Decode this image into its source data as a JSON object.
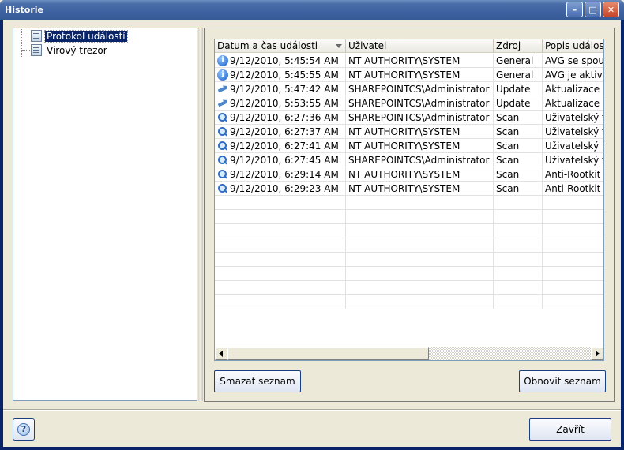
{
  "window": {
    "title": "Historie"
  },
  "tree": {
    "items": [
      {
        "label": "Protokol událostí",
        "selected": true
      },
      {
        "label": "Virový trezor",
        "selected": false
      }
    ]
  },
  "table": {
    "columns": [
      "Datum a čas události",
      "Uživatel",
      "Zdroj",
      "Popis události"
    ],
    "sorted_column": "Datum a čas události",
    "rows": [
      {
        "icon": "info-icon",
        "datetime": "9/12/2010, 5:45:54 AM",
        "user": "NT AUTHORITY\\SYSTEM",
        "source": "General",
        "desc": "AVG se spouš"
      },
      {
        "icon": "info-icon",
        "datetime": "9/12/2010, 5:45:55 AM",
        "user": "NT AUTHORITY\\SYSTEM",
        "source": "General",
        "desc": "AVG je aktivn"
      },
      {
        "icon": "update-icon",
        "datetime": "9/12/2010, 5:47:42 AM",
        "user": "SHAREPOINTCS\\Administrator",
        "source": "Update",
        "desc": "Aktualizace b"
      },
      {
        "icon": "update-icon",
        "datetime": "9/12/2010, 5:53:55 AM",
        "user": "SHAREPOINTCS\\Administrator",
        "source": "Update",
        "desc": "Aktualizace b"
      },
      {
        "icon": "scan-icon",
        "datetime": "9/12/2010, 6:27:36 AM",
        "user": "SHAREPOINTCS\\Administrator",
        "source": "Scan",
        "desc": "Uživatelský te"
      },
      {
        "icon": "scan-icon",
        "datetime": "9/12/2010, 6:27:37 AM",
        "user": "NT AUTHORITY\\SYSTEM",
        "source": "Scan",
        "desc": "Uživatelský te"
      },
      {
        "icon": "scan-icon",
        "datetime": "9/12/2010, 6:27:41 AM",
        "user": "NT AUTHORITY\\SYSTEM",
        "source": "Scan",
        "desc": "Uživatelský te"
      },
      {
        "icon": "scan-icon",
        "datetime": "9/12/2010, 6:27:45 AM",
        "user": "SHAREPOINTCS\\Administrator",
        "source": "Scan",
        "desc": "Uživatelský te"
      },
      {
        "icon": "scan-icon",
        "datetime": "9/12/2010, 6:29:14 AM",
        "user": "NT AUTHORITY\\SYSTEM",
        "source": "Scan",
        "desc": "Anti-Rootkit t"
      },
      {
        "icon": "scan-icon",
        "datetime": "9/12/2010, 6:29:23 AM",
        "user": "NT AUTHORITY\\SYSTEM",
        "source": "Scan",
        "desc": "Anti-Rootkit t"
      }
    ]
  },
  "buttons": {
    "clear_list": "Smazat seznam",
    "refresh_list": "Obnovit seznam",
    "close": "Zavřít",
    "help": "?"
  },
  "titlebar_buttons": {
    "minimize": "–",
    "maximize": "□",
    "close": "✕"
  }
}
